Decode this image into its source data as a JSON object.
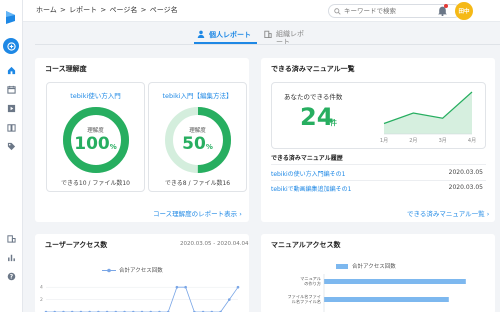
{
  "header": {
    "breadcrumb": [
      "ホーム",
      ">",
      "レポート",
      ">",
      "ページ名",
      ">",
      "ページ名"
    ],
    "search_placeholder": "キーワードで検索",
    "avatar_text": "田中"
  },
  "tabs": [
    {
      "label": "個人レポート"
    },
    {
      "label": "組織レポート"
    }
  ],
  "course_card": {
    "title": "コース理解度",
    "link": "コース理解度のレポート表示",
    "courses": [
      {
        "name": "tebiki使い方入門",
        "label": "理解度",
        "value": "100",
        "unit": "%",
        "progress": 1.0,
        "count_text": "できる10 / ファイル数10"
      },
      {
        "name": "tebiki入門【編集方法】",
        "label": "理解度",
        "value": "50",
        "unit": "%",
        "progress": 0.5,
        "count_text": "できる8 / ファイル数16"
      }
    ]
  },
  "manual_card": {
    "title": "できる済みマニュアル一覧",
    "count_label": "あなたのできる件数",
    "count_value": "24",
    "count_unit": "件",
    "history_title": "できる済みマニュアル履歴",
    "history": [
      {
        "title": "tebikiの使い方入門編その1",
        "date": "2020.03.05"
      },
      {
        "title": "tebikiで動画編集追加編その1",
        "date": "2020.03.05"
      }
    ],
    "link": "できる済みマニュアル一覧"
  },
  "user_access": {
    "title": "ユーザーアクセス数",
    "range": "2020.03.05 - 2020.04.04",
    "legend": "合計アクセス回数",
    "y_ticks": [
      "4",
      "2"
    ]
  },
  "manual_access": {
    "title": "マニュアルアクセス数",
    "legend": "合計アクセス回数",
    "categories": [
      "マニュアルの作り方",
      "ファイル名ファイル名ファイル名"
    ]
  },
  "chart_data": [
    {
      "type": "line",
      "title": "",
      "x": [
        "1月",
        "2月",
        "3月",
        "4月"
      ],
      "series": [
        {
          "values": [
            2,
            4,
            3,
            8
          ]
        }
      ],
      "color": "#27ae60"
    },
    {
      "type": "line",
      "title": "ユーザーアクセス数",
      "series": [
        {
          "name": "合計アクセス回数",
          "values": [
            0,
            0,
            0,
            0,
            0,
            0,
            0,
            0,
            0,
            0,
            0,
            0,
            0,
            0,
            0,
            4,
            4,
            0,
            0,
            0,
            0,
            2,
            4
          ]
        }
      ],
      "y_ticks": [
        2,
        4
      ],
      "color": "#7aa6e6"
    },
    {
      "type": "bar",
      "orientation": "horizontal",
      "title": "マニュアルアクセス数",
      "categories": [
        "マニュアルの作り方",
        "ファイル名ファイル名ファイル名"
      ],
      "series": [
        {
          "name": "合計アクセス回数",
          "values": [
            5,
            4.4
          ]
        }
      ],
      "color": "#7db8ef"
    }
  ]
}
